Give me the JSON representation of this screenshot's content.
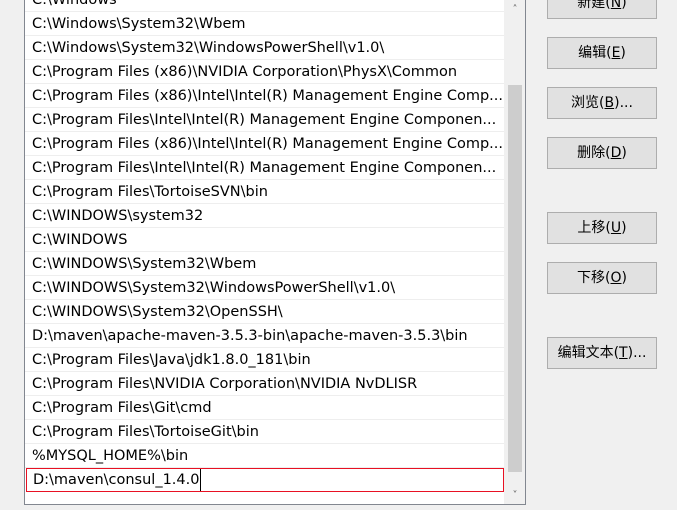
{
  "path_list": {
    "items": [
      "C:\\Windows",
      "C:\\Windows\\System32\\Wbem",
      "C:\\Windows\\System32\\WindowsPowerShell\\v1.0\\",
      "C:\\Program Files (x86)\\NVIDIA Corporation\\PhysX\\Common",
      "C:\\Program Files (x86)\\Intel\\Intel(R) Management Engine Comp...",
      "C:\\Program Files\\Intel\\Intel(R) Management Engine Componen...",
      "C:\\Program Files (x86)\\Intel\\Intel(R) Management Engine Comp...",
      "C:\\Program Files\\Intel\\Intel(R) Management Engine Componen...",
      "C:\\Program Files\\TortoiseSVN\\bin",
      "C:\\WINDOWS\\system32",
      "C:\\WINDOWS",
      "C:\\WINDOWS\\System32\\Wbem",
      "C:\\WINDOWS\\System32\\WindowsPowerShell\\v1.0\\",
      "C:\\WINDOWS\\System32\\OpenSSH\\",
      "D:\\maven\\apache-maven-3.5.3-bin\\apache-maven-3.5.3\\bin",
      "C:\\Program Files\\Java\\jdk1.8.0_181\\bin",
      "C:\\Program Files\\NVIDIA Corporation\\NVIDIA NvDLISR",
      "C:\\Program Files\\Git\\cmd",
      "C:\\Program Files\\TortoiseGit\\bin",
      "%MYSQL_HOME%\\bin",
      "D:\\maven\\consul_1.4.0"
    ],
    "editing_value": "D:\\maven\\consul_1.4.0"
  },
  "buttons": {
    "new": {
      "label": "新建(",
      "key": "N",
      "suffix": ")"
    },
    "edit": {
      "label": "编辑(",
      "key": "E",
      "suffix": ")"
    },
    "browse": {
      "label": "浏览(",
      "key": "B",
      "suffix": ")..."
    },
    "delete": {
      "label": "删除(",
      "key": "D",
      "suffix": ")"
    },
    "move_up": {
      "label": "上移(",
      "key": "U",
      "suffix": ")"
    },
    "move_down": {
      "label": "下移(",
      "key": "O",
      "suffix": ")"
    },
    "edit_text": {
      "label": "编辑文本(",
      "key": "T",
      "suffix": ")..."
    }
  },
  "colors": {
    "selection_border": "#e81123",
    "dialog_background": "#f0f0f0"
  },
  "icons": {
    "scroll_up": "chevron-up-icon",
    "scroll_down": "chevron-down-icon"
  }
}
